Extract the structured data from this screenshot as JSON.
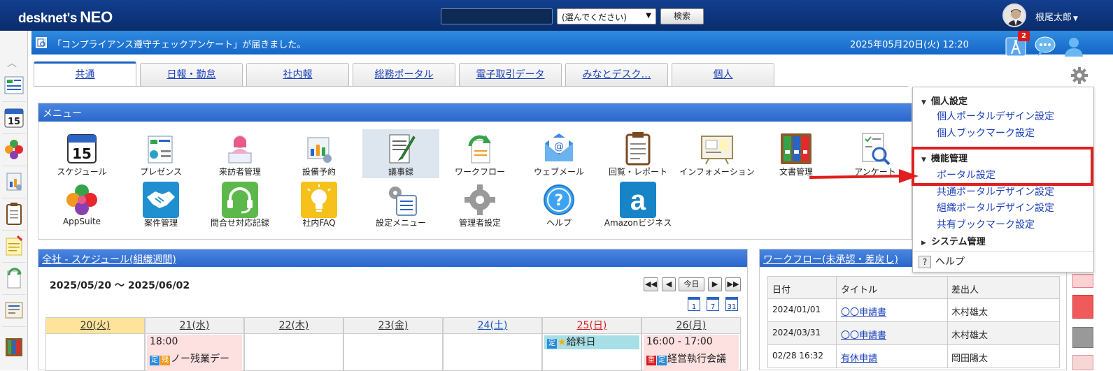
{
  "topbar": {
    "logo": "desknet's",
    "logo_neo": "NEO",
    "search_select": "(選んでください)",
    "search_button": "検索",
    "user_name": "根尾太郎"
  },
  "notification": {
    "text": "「コンプライアンス遵守チェックアンケート」が届きました。",
    "datetime": "2025年05月20日(火) 12:20",
    "badge_count": "2"
  },
  "tabs": [
    {
      "label": "共通",
      "active": true
    },
    {
      "label": "日報・勤怠"
    },
    {
      "label": "社内報"
    },
    {
      "label": "総務ポータル"
    },
    {
      "label": "電子取引データ"
    },
    {
      "label": "みなとデスク…"
    },
    {
      "label": "個人"
    }
  ],
  "menu": {
    "title": "メニュー",
    "items": [
      {
        "label": "スケジュール",
        "icon": "calendar-icon"
      },
      {
        "label": "プレゼンス",
        "icon": "presence-icon"
      },
      {
        "label": "来訪者管理",
        "icon": "visitor-icon"
      },
      {
        "label": "設備予約",
        "icon": "equipment-icon"
      },
      {
        "label": "議事録",
        "icon": "minutes-icon"
      },
      {
        "label": "ワークフロー",
        "icon": "workflow-icon"
      },
      {
        "label": "ウェブメール",
        "icon": "webmail-icon"
      },
      {
        "label": "回覧・レポート",
        "icon": "clipboard-icon"
      },
      {
        "label": "インフォメーション",
        "icon": "information-icon"
      },
      {
        "label": "文書管理",
        "icon": "documents-icon"
      },
      {
        "label": "アンケート",
        "icon": "survey-icon"
      },
      {
        "label": "AppSuite",
        "icon": "appsuite-icon"
      },
      {
        "label": "案件管理",
        "icon": "handshake-icon"
      },
      {
        "label": "問合せ対応記録",
        "icon": "headset-icon"
      },
      {
        "label": "社内FAQ",
        "icon": "lightbulb-icon"
      },
      {
        "label": "設定メニュー",
        "icon": "settings-menu-icon"
      },
      {
        "label": "管理者設定",
        "icon": "admin-gear-icon"
      },
      {
        "label": "ヘルプ",
        "icon": "help-icon"
      },
      {
        "label": "Amazonビジネス",
        "icon": "amazon-icon"
      }
    ]
  },
  "schedule": {
    "title": "全社 - スケジュール(組織週間)",
    "range": "2025/05/20 ～ 2025/06/02",
    "today_button": "今日",
    "view_icons": [
      "1",
      "7",
      "31"
    ],
    "days": [
      "20(火)",
      "21(水)",
      "22(木)",
      "23(金)",
      "24(土)",
      "25(日)",
      "26(月)"
    ],
    "events": {
      "d21_time": "18:00",
      "d21_title": "ノー残業デー",
      "d25_title": "給料日",
      "d26_time": "16:00 - 17:00",
      "d26_title": "経営執行会議"
    },
    "badge_fixed": "定",
    "badge_important": "重"
  },
  "workflow": {
    "title": "ワークフロー(未承認・差戻し)",
    "headers": [
      "日付",
      "タイトル",
      "差出人"
    ],
    "rows": [
      {
        "date": "2024/01/01",
        "title": "〇〇申請書",
        "sender": "木村雄太"
      },
      {
        "date": "2024/03/31",
        "title": "〇〇申請書",
        "sender": "木村雄太"
      },
      {
        "date": "02/28 16:32",
        "title": "有休申請",
        "sender": "岡田陽太"
      }
    ]
  },
  "dropdown": {
    "personal_section": "個人設定",
    "personal_items": [
      "個人ポータルデザイン設定",
      "個人ブックマーク設定"
    ],
    "function_section": "機能管理",
    "function_items": [
      "ポータル設定",
      "共通ポータルデザイン設定",
      "組織ポータルデザイン設定",
      "共有ブックマーク設定"
    ],
    "system_section": "システム管理",
    "help": "ヘルプ"
  },
  "colors": {
    "header_dark": "#0a2c6b",
    "header_blue": "#1565c8",
    "annotation_red": "#e02020"
  }
}
